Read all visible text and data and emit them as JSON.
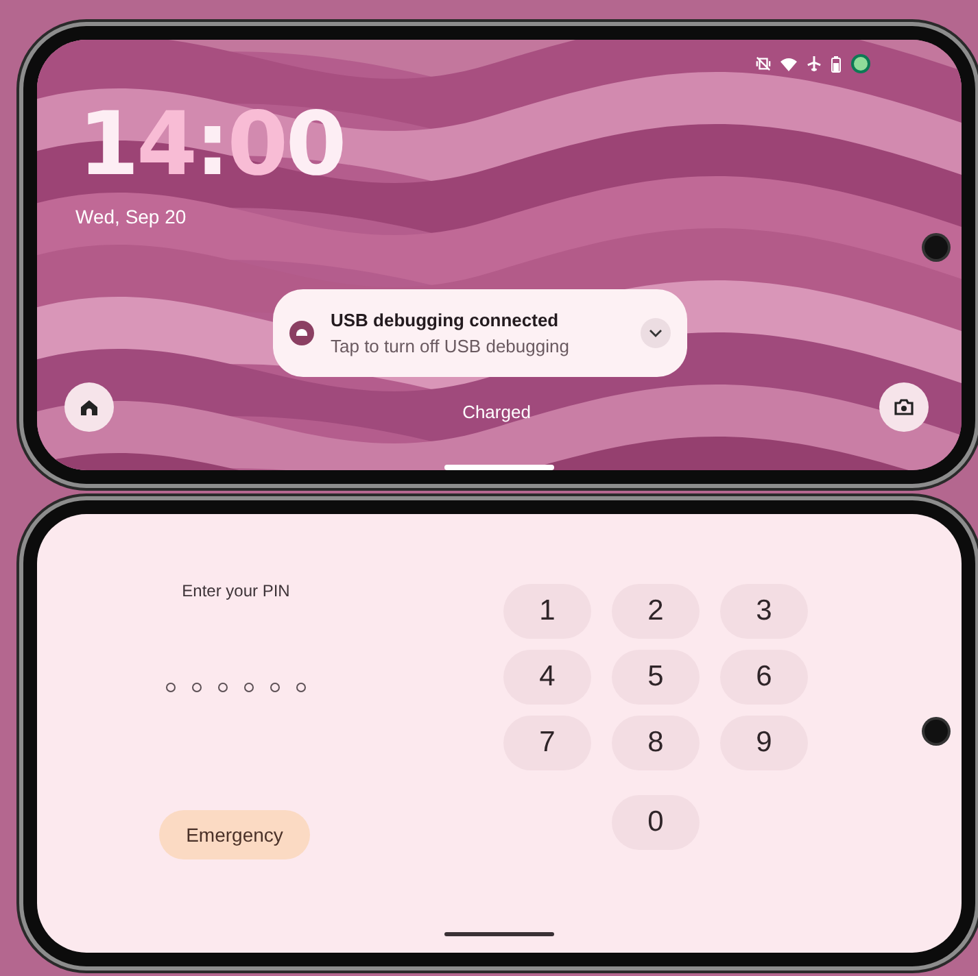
{
  "outer_screen": {
    "clock": "14:00",
    "date": "Wed, Sep 20",
    "notification": {
      "title": "USB debugging connected",
      "text": "Tap to turn off USB debugging",
      "expanded": false
    },
    "status": "Charged"
  },
  "pin_screen": {
    "prompt": "Enter your PIN",
    "pin_slots": [
      {
        "filled": false
      },
      {
        "filled": false
      },
      {
        "filled": false
      },
      {
        "filled": false
      },
      {
        "filled": false
      },
      {
        "filled": false
      }
    ],
    "emergency_button": "Emergency",
    "keypad": [
      {
        "label": "1"
      },
      {
        "label": "2"
      },
      {
        "label": "3"
      },
      {
        "label": "4"
      },
      {
        "label": "5"
      },
      {
        "label": "6"
      },
      {
        "label": "7"
      },
      {
        "label": "8"
      },
      {
        "label": "9"
      },
      {
        "label": "0"
      }
    ]
  }
}
